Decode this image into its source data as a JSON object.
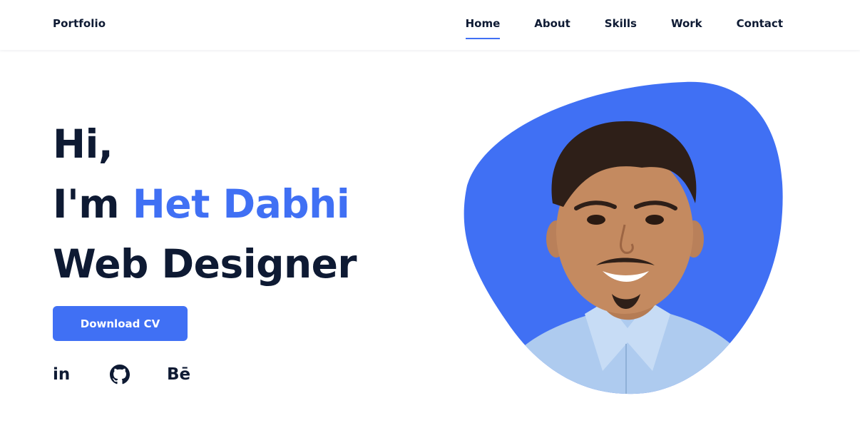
{
  "header": {
    "logo": "Portfolio",
    "nav": [
      {
        "label": "Home",
        "active": true
      },
      {
        "label": "About",
        "active": false
      },
      {
        "label": "Skills",
        "active": false
      },
      {
        "label": "Work",
        "active": false
      },
      {
        "label": "Contact",
        "active": false
      }
    ]
  },
  "hero": {
    "greeting": "Hi,",
    "intro_prefix": "I'm ",
    "name": "Het Dabhi",
    "role": "Web Designer",
    "cv_button": "Download CV"
  },
  "socials": [
    {
      "name": "linkedin-icon",
      "label": "in"
    },
    {
      "name": "github-icon",
      "label": ""
    },
    {
      "name": "behance-icon",
      "label": "Bē"
    }
  ],
  "colors": {
    "accent": "#4070f4",
    "title": "#0e1a33",
    "background": "#ffffff"
  }
}
